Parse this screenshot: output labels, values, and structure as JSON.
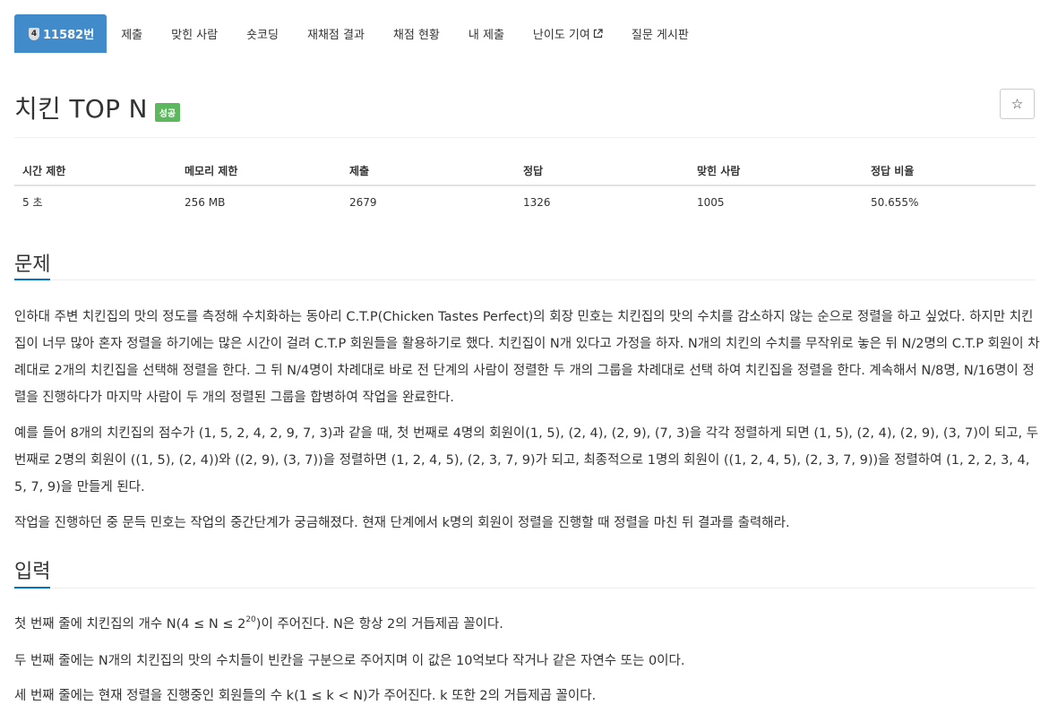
{
  "nav": {
    "tier_badge": "4",
    "problem_number": "11582번",
    "tabs": [
      "제출",
      "맞힌 사람",
      "숏코딩",
      "재채점 결과",
      "채점 현황",
      "내 제출",
      "난이도 기여",
      "질문 게시판"
    ]
  },
  "title": "치킨 TOP N",
  "result_badge": "성공",
  "star_icon": "☆",
  "info_table": {
    "headers": [
      "시간 제한",
      "메모리 제한",
      "제출",
      "정답",
      "맞힌 사람",
      "정답 비율"
    ],
    "values": [
      "5 초",
      "256 MB",
      "2679",
      "1326",
      "1005",
      "50.655%"
    ]
  },
  "sections": {
    "problem_heading": "문제",
    "input_heading": "입력"
  },
  "problem": {
    "p1": "인하대 주변 치킨집의 맛의 정도를 측정해 수치화하는 동아리 C.T.P(Chicken Tastes Perfect)의 회장 민호는 치킨집의 맛의 수치를 감소하지 않는 순으로 정렬을 하고 싶었다. 하지만 치킨집이 너무 많아 혼자 정렬을 하기에는 많은 시간이 걸려 C.T.P 회원들을 활용하기로 했다. 치킨집이 N개 있다고 가정을 하자. N개의 치킨의 수치를 무작위로 놓은 뒤 N/2명의 C.T.P 회원이 차례대로 2개의 치킨집을 선택해  정렬을 한다. 그 뒤 N/4명이 차례대로 바로 전 단계의 사람이 정렬한 두 개의 그룹을 차례대로 선택 하여 치킨집을 정렬을 한다. 계속해서 N/8명, N/16명이 정렬을 진행하다가 마지막 사람이 두 개의 정렬된 그룹을 합병하여 작업을 완료한다.",
    "p2": "예를 들어 8개의 치킨집의 점수가 (1, 5, 2, 4, 2, 9, 7, 3)과 같을 때, 첫 번째로 4명의 회원이(1, 5), (2, 4), (2, 9), (7, 3)을 각각 정렬하게 되면 (1, 5), (2, 4), (2, 9), (3, 7)이 되고, 두 번째로 2명의 회원이 ((1, 5), (2, 4))와 ((2, 9), (3, 7))을 정렬하면 (1, 2, 4, 5), (2, 3, 7, 9)가 되고, 최종적으로 1명의 회원이 ((1, 2, 4, 5), (2, 3, 7, 9))을 정렬하여 (1, 2, 2, 3, 4, 5, 7, 9)을 만들게 된다.",
    "p3": "작업을 진행하던 중 문득 민호는 작업의 중간단계가 궁금해졌다. 현재 단계에서 k명의 회원이 정렬을 진행할 때 정렬을 마친 뒤 결과를 출력해라."
  },
  "input": {
    "l1_before": "첫 번째 줄에 치킨집의 개수 N(4 ≤ N ≤ 2",
    "l1_exp": "20",
    "l1_after": ")이 주어진다. N은 항상 2의 거듭제곱 꼴이다.",
    "l2": "두 번째 줄에는 N개의 치킨집의 맛의 수치들이 빈칸을 구분으로 주어지며 이 값은 10억보다 작거나 같은 자연수 또는 0이다.",
    "l3": "세 번째 줄에는 현재 정렬을 진행중인 회원들의 수 k(1 ≤ k < N)가 주어진다. k 또한 2의 거듭제곱 꼴이다."
  }
}
